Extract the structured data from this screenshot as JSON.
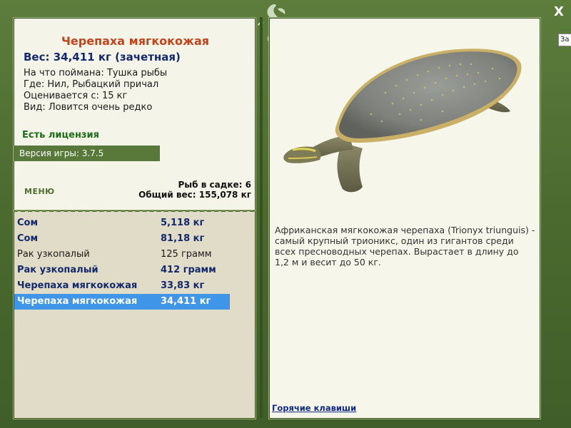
{
  "fish": {
    "title": "Черепаха мягкокожая",
    "weight_line": "Вес: 34,411 кг (зачетная)",
    "caught_on": "На что поймана: Тушка рыбы",
    "location": "Где: Нил, Рыбацкий причал",
    "valued_from": "Оценивается с: 15 кг",
    "rarity": "Вид: Ловится очень редко",
    "license": "Есть лицензия",
    "description": "Африканская мягкокожая черепаха (Trionyx triunguis) - самый крупный трионикс, один из гигантов среди всех пресноводных черепах. Вырастает в длину до 1,2 м и весит до 50 кг."
  },
  "version": "Версия игры: 3.7.5",
  "menu_label": "МЕНЮ",
  "keepnet": {
    "count": "Рыб в садке: 6",
    "total": "Общий вес: 155,078 кг"
  },
  "catch_list": [
    {
      "name": "Сом",
      "weight": "5,118 кг"
    },
    {
      "name": "Сом",
      "weight": "81,18 кг"
    },
    {
      "name": "Рак узкопалый",
      "weight": "125 грамм"
    },
    {
      "name": "Рак узкопалый",
      "weight": "412 грамм"
    },
    {
      "name": "Черепаха мягкокожая",
      "weight": "33,83 кг"
    },
    {
      "name": "Черепаха мягкокожая",
      "weight": "34,411 кг"
    }
  ],
  "hotkeys_label": "Горячие клавиши",
  "close_label": "X",
  "tooltip_partial": "За",
  "colors": {
    "frame_green": "#4e6d33",
    "title_orange": "#c0451c",
    "navy_text": "#13296b",
    "license_green": "#1e6c1a",
    "selection_blue": "#3f95e8"
  }
}
